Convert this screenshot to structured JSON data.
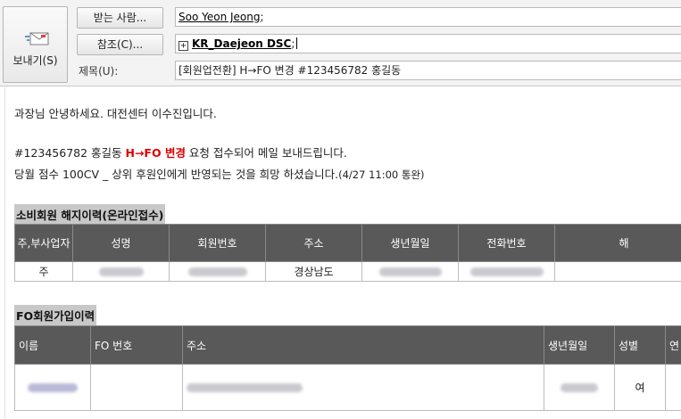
{
  "compose": {
    "send_label": "보내기(S)",
    "to_button": "받는 사람...",
    "cc_button": "참조(C)...",
    "subject_label": "제목(U):",
    "to_value": "Soo Yeon Jeong",
    "to_separator": ";",
    "cc_expand": "+",
    "cc_value": "KR_Daejeon DSC",
    "cc_separator": ";",
    "subject_value": "[회원업전환] H→FO 변경 #123456782 홍길동"
  },
  "message": {
    "greeting": "과장님 안녕하세요. 대전센터 이수진입니다.",
    "request_prefix": "#123456782 홍길동 ",
    "request_highlight": "H→FO 변경",
    "request_suffix": " 요청 접수되어 메일 보내드립니다.",
    "points_main": "당월 점수 100CV _ 상위 후원인에게 반영되는 것을 희망 하셨습니다.",
    "points_note": "(4/27 11:00 통완)"
  },
  "section1": {
    "title": "소비회원 해지이력(온라인접수)",
    "headers": [
      "주,부사업자",
      "성명",
      "회원번호",
      "주소",
      "생년월일",
      "전화번호",
      "해"
    ],
    "row": {
      "type": "주",
      "address": "경상남도"
    }
  },
  "section2": {
    "title": "FO회원가입이력",
    "headers": [
      "이름",
      "FO 번호",
      "주소",
      "생년월일",
      "성별",
      "연"
    ],
    "row": {
      "gender": "여"
    }
  },
  "colors": {
    "highlight_red": "#e00000",
    "table_header_bg": "#595959",
    "section_title_bg": "#c8c8c8"
  }
}
